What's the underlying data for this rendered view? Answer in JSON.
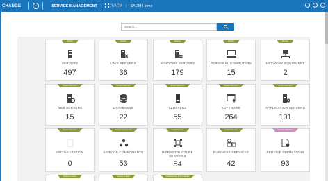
{
  "header": {
    "logo_text": "CHANGE",
    "app_title": "SERVICE MANAGEMENT",
    "nav_sacm": "SACM",
    "nav_sacm_home": "SACM Home",
    "crumb_separator": "|"
  },
  "search": {
    "placeholder": "Search..."
  },
  "colors": {
    "header": "#1b75bb",
    "tag_green": "#8c9a3b",
    "tag_pink": "#d58ac6"
  },
  "tiles": [
    {
      "tag": "Device",
      "label": "SERVERS",
      "count": "497",
      "icon": "server-icon"
    },
    {
      "tag": "Device",
      "label": "UNIX SERVERS",
      "count": "36",
      "icon": "unix-server-icon"
    },
    {
      "tag": "Device",
      "label": "WINDOWS SERVERS",
      "count": "179",
      "icon": "windows-server-icon"
    },
    {
      "tag": "Device",
      "label": "PERSONAL COMPUTERS",
      "count": "15",
      "icon": "monitor-icon"
    },
    {
      "tag": "Device",
      "label": "NETWORK EQUIPMENT",
      "count": "2",
      "icon": "network-icon"
    },
    {
      "tag": "System Element",
      "label": "WEB SERVERS",
      "count": "15",
      "icon": "web-server-icon"
    },
    {
      "tag": "System Element",
      "label": "DATABASES",
      "count": "22",
      "icon": "database-icon"
    },
    {
      "tag": "System Element",
      "label": "CLUSTERS",
      "count": "55",
      "icon": "cluster-icon"
    },
    {
      "tag": "System Element",
      "label": "SOFTWARE",
      "count": "264",
      "icon": "software-icon"
    },
    {
      "tag": "System Element",
      "label": "APPLICATION SERVERS",
      "count": "191",
      "icon": "app-server-icon"
    },
    {
      "tag": "System Element",
      "label": "VIRTUALIZATION",
      "count": "0",
      "icon": "virtualization-icon"
    },
    {
      "tag": "Service Component",
      "label": "SERVICE COMPONENTS",
      "count": "53",
      "icon": "components-icon"
    },
    {
      "tag": "Actual Service",
      "label": "INFRASTRUCTURE SERVICES",
      "count": "54",
      "icon": "infrastructure-icon"
    },
    {
      "tag": "Actual Service",
      "label": "BUSINESS SERVICES",
      "count": "42",
      "icon": "business-services-icon"
    },
    {
      "tag": "Service Definition",
      "label": "SERVICE DEFINITIONS",
      "count": "93",
      "icon": "definition-icon"
    }
  ],
  "partial_tags": [
    "Access to users",
    "Access to data",
    "Infrastructure & Peripherals"
  ]
}
